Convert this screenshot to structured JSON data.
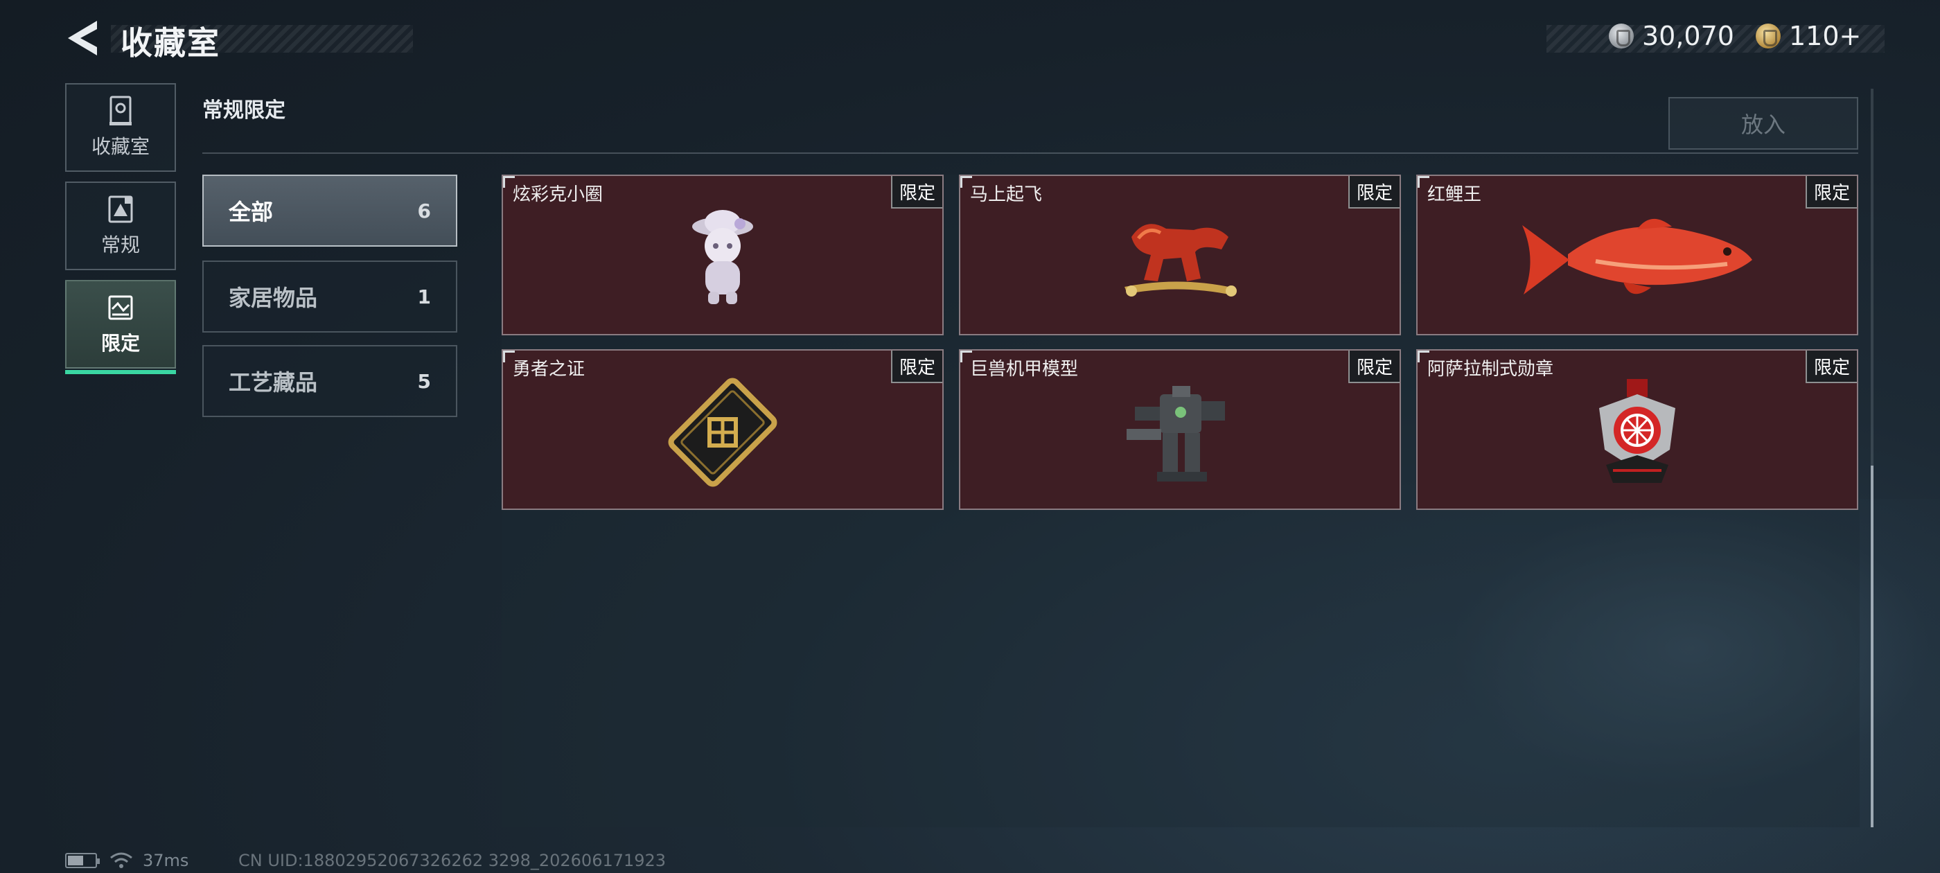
{
  "header": {
    "title": "收藏室",
    "currencies": [
      {
        "icon": "silver-coin-icon",
        "value": "30,070"
      },
      {
        "icon": "gold-coin-icon",
        "value": "110+"
      }
    ]
  },
  "side_nav": [
    {
      "label": "收藏室",
      "icon": "display-case-icon",
      "active": false
    },
    {
      "label": "常规",
      "icon": "picture-frame-icon",
      "active": false
    },
    {
      "label": "限定",
      "icon": "landscape-frame-icon",
      "active": true
    }
  ],
  "section": {
    "title": "常规限定",
    "put_in_label": "放入"
  },
  "filters": [
    {
      "label": "全部",
      "count": "6",
      "active": true
    },
    {
      "label": "家居物品",
      "count": "1",
      "active": false
    },
    {
      "label": "工艺藏品",
      "count": "5",
      "active": false
    }
  ],
  "items": [
    {
      "name": "炫彩克小圈",
      "badge": "限定",
      "icon": "figurine-icon"
    },
    {
      "name": "马上起飞",
      "badge": "限定",
      "icon": "horse-statue-icon"
    },
    {
      "name": "红鲤王",
      "badge": "限定",
      "icon": "carp-fish-icon"
    },
    {
      "name": "勇者之证",
      "badge": "限定",
      "icon": "gold-card-icon"
    },
    {
      "name": "巨兽机甲模型",
      "badge": "限定",
      "icon": "mech-model-icon"
    },
    {
      "name": "阿萨拉制式勋章",
      "badge": "限定",
      "icon": "medal-icon"
    }
  ],
  "status": {
    "ping": "37ms",
    "uid": "CN UID:18802952067326262 3298_202606171923"
  }
}
